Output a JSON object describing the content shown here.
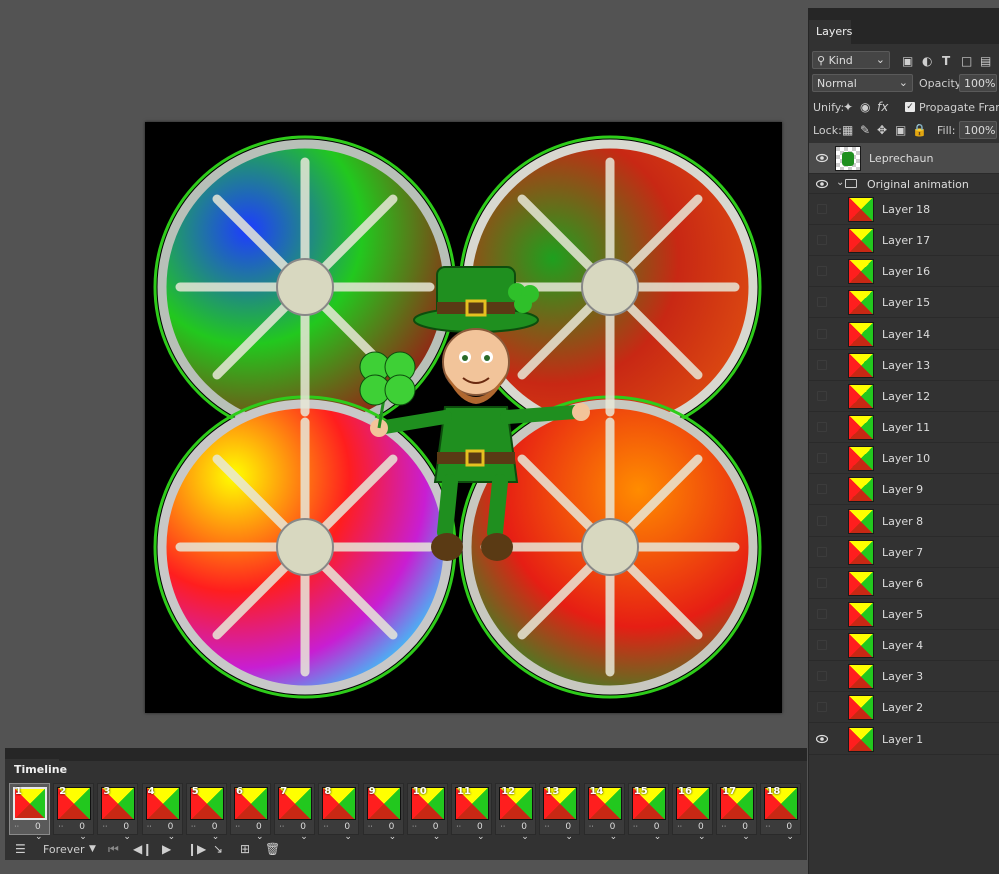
{
  "layers_panel": {
    "tab": "Layers",
    "filter_kind": "Kind",
    "blend_mode": "Normal",
    "opacity_label": "Opacity:",
    "opacity_value": "100%",
    "unify_label": "Unify:",
    "propagate_label": "Propagate Frame",
    "lock_label": "Lock:",
    "fill_label": "Fill:",
    "fill_value": "100%",
    "group_name": "Original animation",
    "layers": [
      {
        "name": "Leprechaun",
        "visible": true,
        "selected": true,
        "type": "smart-object"
      },
      {
        "name": "Layer 18",
        "visible": false
      },
      {
        "name": "Layer 17",
        "visible": false
      },
      {
        "name": "Layer 16",
        "visible": false
      },
      {
        "name": "Layer 15",
        "visible": false
      },
      {
        "name": "Layer 14",
        "visible": false
      },
      {
        "name": "Layer 13",
        "visible": false
      },
      {
        "name": "Layer 12",
        "visible": false
      },
      {
        "name": "Layer 11",
        "visible": false
      },
      {
        "name": "Layer 10",
        "visible": false
      },
      {
        "name": "Layer 9",
        "visible": false
      },
      {
        "name": "Layer 8",
        "visible": false
      },
      {
        "name": "Layer 7",
        "visible": false
      },
      {
        "name": "Layer 6",
        "visible": false
      },
      {
        "name": "Layer 5",
        "visible": false
      },
      {
        "name": "Layer 4",
        "visible": false
      },
      {
        "name": "Layer 3",
        "visible": false
      },
      {
        "name": "Layer 2",
        "visible": false
      },
      {
        "name": "Layer 1",
        "visible": true
      }
    ]
  },
  "timeline": {
    "tab": "Timeline",
    "loop": "Forever",
    "frames": [
      {
        "num": "1",
        "delay": "0"
      },
      {
        "num": "2",
        "delay": "0"
      },
      {
        "num": "3",
        "delay": "0"
      },
      {
        "num": "4",
        "delay": "0"
      },
      {
        "num": "5",
        "delay": "0"
      },
      {
        "num": "6",
        "delay": "0"
      },
      {
        "num": "7",
        "delay": "0"
      },
      {
        "num": "8",
        "delay": "0"
      },
      {
        "num": "9",
        "delay": "0"
      },
      {
        "num": "10",
        "delay": "0"
      },
      {
        "num": "11",
        "delay": "0"
      },
      {
        "num": "12",
        "delay": "0"
      },
      {
        "num": "13",
        "delay": "0"
      },
      {
        "num": "14",
        "delay": "0"
      },
      {
        "num": "15",
        "delay": "0"
      },
      {
        "num": "16",
        "delay": "0"
      },
      {
        "num": "17",
        "delay": "0"
      },
      {
        "num": "18",
        "delay": "0"
      }
    ],
    "selected_frame": 1
  },
  "canvas": {
    "wheel_colors": {
      "top_left": [
        "#1e3cff",
        "#22c81e",
        "#c81e1e"
      ],
      "top_right": [
        "#1ea01e",
        "#c82814",
        "#e05010"
      ],
      "bottom_left": [
        "#ffff00",
        "#ff1e1e",
        "#c81ed2",
        "#1ee6ff"
      ],
      "bottom_right": [
        "#ff8c00",
        "#e61e14",
        "#1e9628"
      ]
    },
    "ring_color": "#2ecc1a",
    "leprechaun_green": "#1f8f1f"
  }
}
